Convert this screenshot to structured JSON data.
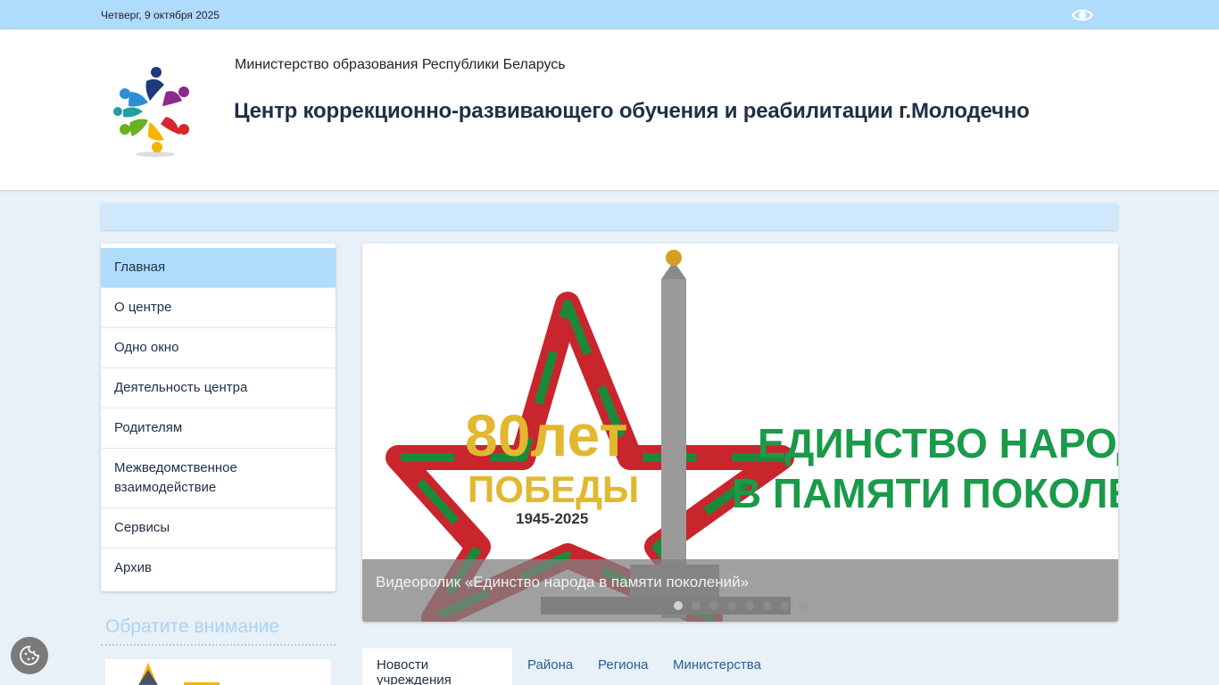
{
  "topbar": {
    "date": "Четверг, 9 октября 2025",
    "accessibility_icon": "eye-icon"
  },
  "header": {
    "ministry": "Министерство образования Республики Беларусь",
    "title": "Центр коррекционно-развивающего обучения и реабилитации г.Молодечно"
  },
  "sidebar": {
    "items": [
      {
        "label": "Главная",
        "active": true
      },
      {
        "label": "О центре"
      },
      {
        "label": "Одно окно"
      },
      {
        "label": "Деятельность центра"
      },
      {
        "label": "Родителям"
      },
      {
        "label": "Межведомственное взаимодействие"
      },
      {
        "label": "Сервисы"
      },
      {
        "label": "Архив"
      }
    ],
    "attention_title": "Обратите внимание"
  },
  "slider": {
    "image_text": {
      "years_big": "80лет",
      "victory": "ПОБЕДЫ",
      "years_range": "1945-2025",
      "slogan_line1": "ЕДИНСТВО НАРОДА",
      "slogan_line2": "В ПАМЯТИ ПОКОЛЕНИЙ"
    },
    "caption": "Видеоролик «Единство народа в памяти поколений»",
    "slide_count": 8,
    "active_slide": 1
  },
  "news_tabs": [
    {
      "label": "Новости учреждения",
      "active": true
    },
    {
      "label": "Района"
    },
    {
      "label": "Региона"
    },
    {
      "label": "Министерства"
    }
  ],
  "colors": {
    "topbar": "#b0dcfc",
    "active_menu": "#b0dcfc",
    "link": "#2a5e99",
    "attention": "#a8d4f4"
  }
}
